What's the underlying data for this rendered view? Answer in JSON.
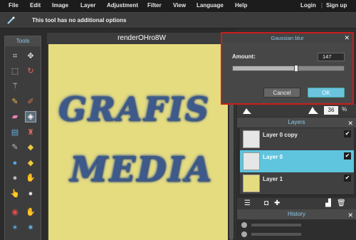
{
  "menu": {
    "items": [
      "File",
      "Edit",
      "Image",
      "Layer",
      "Adjustment",
      "Filter",
      "View",
      "Language",
      "Help"
    ],
    "login": "Login",
    "separator": "|",
    "signup": "Sign up"
  },
  "options_bar": {
    "tool_icon": "magic-wand-icon",
    "message": "This tool has no additional options"
  },
  "tools": {
    "title": "Tools",
    "icons": [
      "crop-icon",
      "move-icon",
      "marquee-icon",
      "lasso-icon",
      "magic-wand-icon",
      "pencil-icon",
      "brush-icon",
      "eraser-icon",
      "paint-bucket-icon",
      "gradient-icon",
      "clone-stamp-icon",
      "color-replace-icon",
      "shape-icon",
      "drop-icon",
      "sharpen-icon",
      "blur-icon",
      "sponge-icon",
      "smudge-icon",
      "dodge-icon",
      "red-eye-icon",
      "burn-icon",
      "bloat-icon",
      "pinch-icon",
      "text-icon"
    ]
  },
  "document": {
    "title": "renderOHro8W",
    "canvas_color": "#e5dc7f",
    "art_text": [
      "GRAFIS",
      "MEDIA"
    ]
  },
  "dialog": {
    "title": "Gaussian blur",
    "amount_label": "Amount:",
    "amount_value": "147",
    "slider_fraction": 0.57,
    "cancel_label": "Cancel",
    "ok_label": "OK"
  },
  "opacity": {
    "value": "36",
    "unit": "%"
  },
  "layers": {
    "title": "Layers",
    "items": [
      {
        "name": "Layer 0 copy",
        "selected": false,
        "checked": true
      },
      {
        "name": "Layer 0",
        "selected": true,
        "checked": true
      },
      {
        "name": "Layer 1",
        "selected": false,
        "checked": true
      }
    ]
  },
  "history": {
    "title": "History"
  },
  "colors": {
    "accent": "#5fc4dd",
    "dialog_highlight": "#cc1d1d",
    "art_text": "#3d5a8a"
  }
}
